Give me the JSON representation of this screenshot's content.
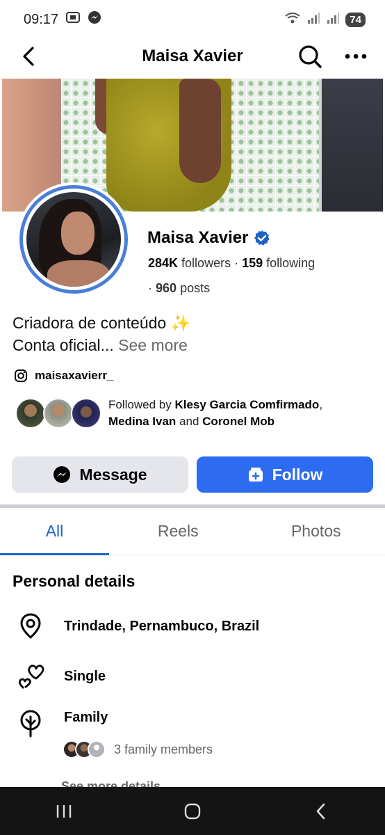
{
  "status_bar": {
    "time": "09:17",
    "battery": "74"
  },
  "header": {
    "title": "Maisa Xavier"
  },
  "profile": {
    "name": "Maisa Xavier",
    "followers_count": "284K",
    "followers_label": "followers",
    "following_count": "159",
    "following_label": "following",
    "posts_count": "960",
    "posts_label": "posts",
    "bio_line1": "Criadora de conteúdo ✨",
    "bio_line2": "Conta oficial...",
    "see_more": "See more",
    "instagram": "maisaxavierr_",
    "followed_by_prefix": "Followed by",
    "followed_by_1": "Klesy Garcia Comfirmado",
    "followed_by_2": "Medina Ivan",
    "followed_by_and": "and",
    "followed_by_3": "Coronel Mob"
  },
  "actions": {
    "message_label": "Message",
    "follow_label": "Follow"
  },
  "tabs": [
    {
      "label": "All"
    },
    {
      "label": "Reels"
    },
    {
      "label": "Photos"
    }
  ],
  "details": {
    "section_title": "Personal details",
    "location": "Trindade, Pernambuco, Brazil",
    "relationship": "Single",
    "family_label": "Family",
    "family_members": "3 family members",
    "see_more_details": "See more details"
  },
  "colors": {
    "accent": "#2d6cf0",
    "tab_active": "#1b62c8",
    "nav_bar": "#141414"
  }
}
